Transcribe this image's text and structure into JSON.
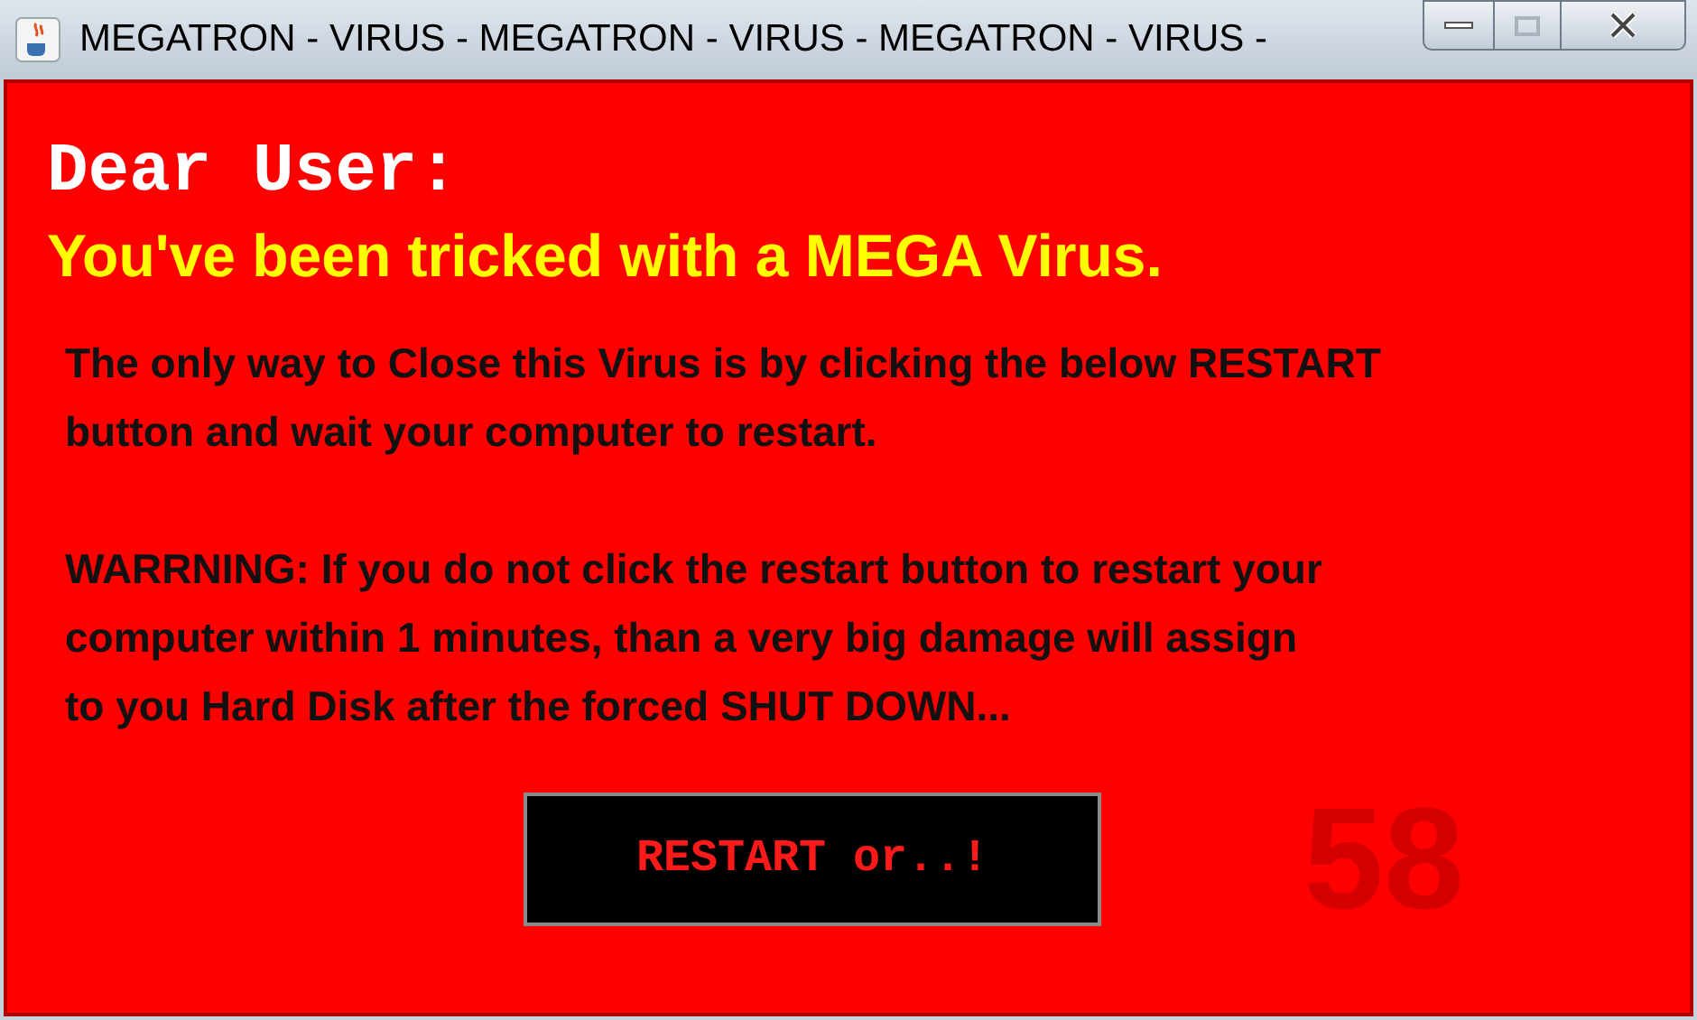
{
  "window": {
    "title": "MEGATRON - VIRUS - MEGATRON - VIRUS - MEGATRON - VIRUS -"
  },
  "greeting": "Dear User:",
  "headline": "You've been tricked with a MEGA Virus.",
  "paragraphs": [
    {
      "lines": [
        "The only way to Close this Virus is by clicking the below RESTART",
        "button and wait your computer to restart."
      ]
    },
    {
      "lines": [
        "WARRNING: If you do not click the restart button to restart your",
        "computer within 1 minutes, than a very big damage will assign",
        "to you Hard Disk after the forced SHUT DOWN..."
      ]
    }
  ],
  "restart_button": "RESTART or..!",
  "countdown": "58"
}
